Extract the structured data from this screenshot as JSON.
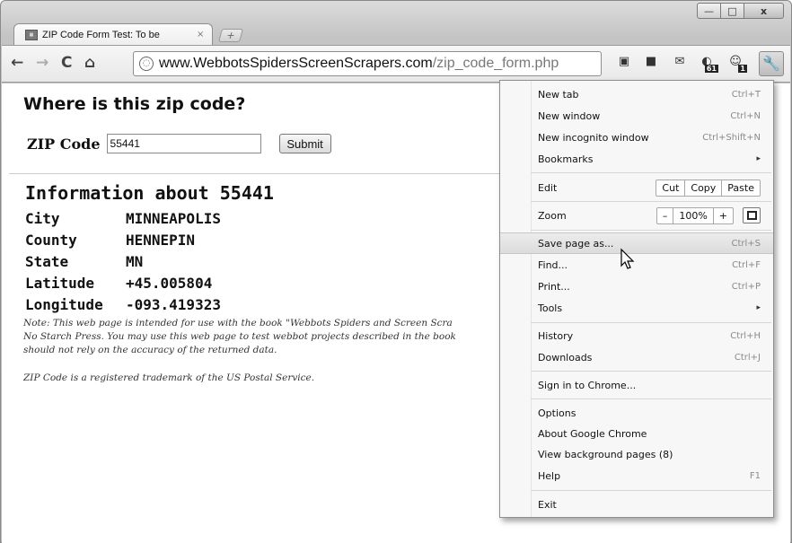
{
  "window": {
    "tab_title": "ZIP Code Form Test: To be",
    "tab_close": "×",
    "new_tab": "+",
    "minimize": "—",
    "maximize": "□",
    "close": "x"
  },
  "toolbar": {
    "back": "←",
    "forward": "→",
    "reload": "C",
    "home": "⌂",
    "url_host": "www.WebbotsSpidersScreenScrapers.com",
    "url_path": "/zip_code_form.php",
    "ext_badge": "1",
    "ext_badge2": "61"
  },
  "page": {
    "title": "Where is this zip code?",
    "zip_label": "ZIP Code",
    "zip_value": "55441",
    "submit_label": "Submit",
    "info_heading": "Information about 55441",
    "rows": [
      {
        "key": "City",
        "value": "MINNEAPOLIS"
      },
      {
        "key": "County",
        "value": "HENNEPIN"
      },
      {
        "key": "State",
        "value": "MN"
      },
      {
        "key": "Latitude",
        "value": "+45.005804"
      },
      {
        "key": "Longitude",
        "value": "-093.419323"
      }
    ],
    "note_line1": "Note: This web page is intended for use with the book \"Webbots Spiders and Screen Scra",
    "note_line2": "No Starch Press. You may use this web page to test webbot projects described in the book",
    "note_line3": "should not rely on the accuracy of the returned data.",
    "trademark": "ZIP Code is a registered trademark of the US Postal Service."
  },
  "menu": {
    "new_tab": "New tab",
    "new_tab_sc": "Ctrl+T",
    "new_window": "New window",
    "new_window_sc": "Ctrl+N",
    "incognito": "New incognito window",
    "incognito_sc": "Ctrl+Shift+N",
    "bookmarks": "Bookmarks",
    "edit": "Edit",
    "cut": "Cut",
    "copy": "Copy",
    "paste": "Paste",
    "zoom": "Zoom",
    "zoom_minus": "–",
    "zoom_level": "100%",
    "zoom_plus": "+",
    "save_page": "Save page as...",
    "save_page_sc": "Ctrl+S",
    "find": "Find...",
    "find_sc": "Ctrl+F",
    "print": "Print...",
    "print_sc": "Ctrl+P",
    "tools": "Tools",
    "history": "History",
    "history_sc": "Ctrl+H",
    "downloads": "Downloads",
    "downloads_sc": "Ctrl+J",
    "sign_in": "Sign in to Chrome...",
    "options": "Options",
    "about": "About Google Chrome",
    "background": "View background pages (8)",
    "help": "Help",
    "help_sc": "F1",
    "exit": "Exit",
    "submenu_arrow": "▸"
  }
}
